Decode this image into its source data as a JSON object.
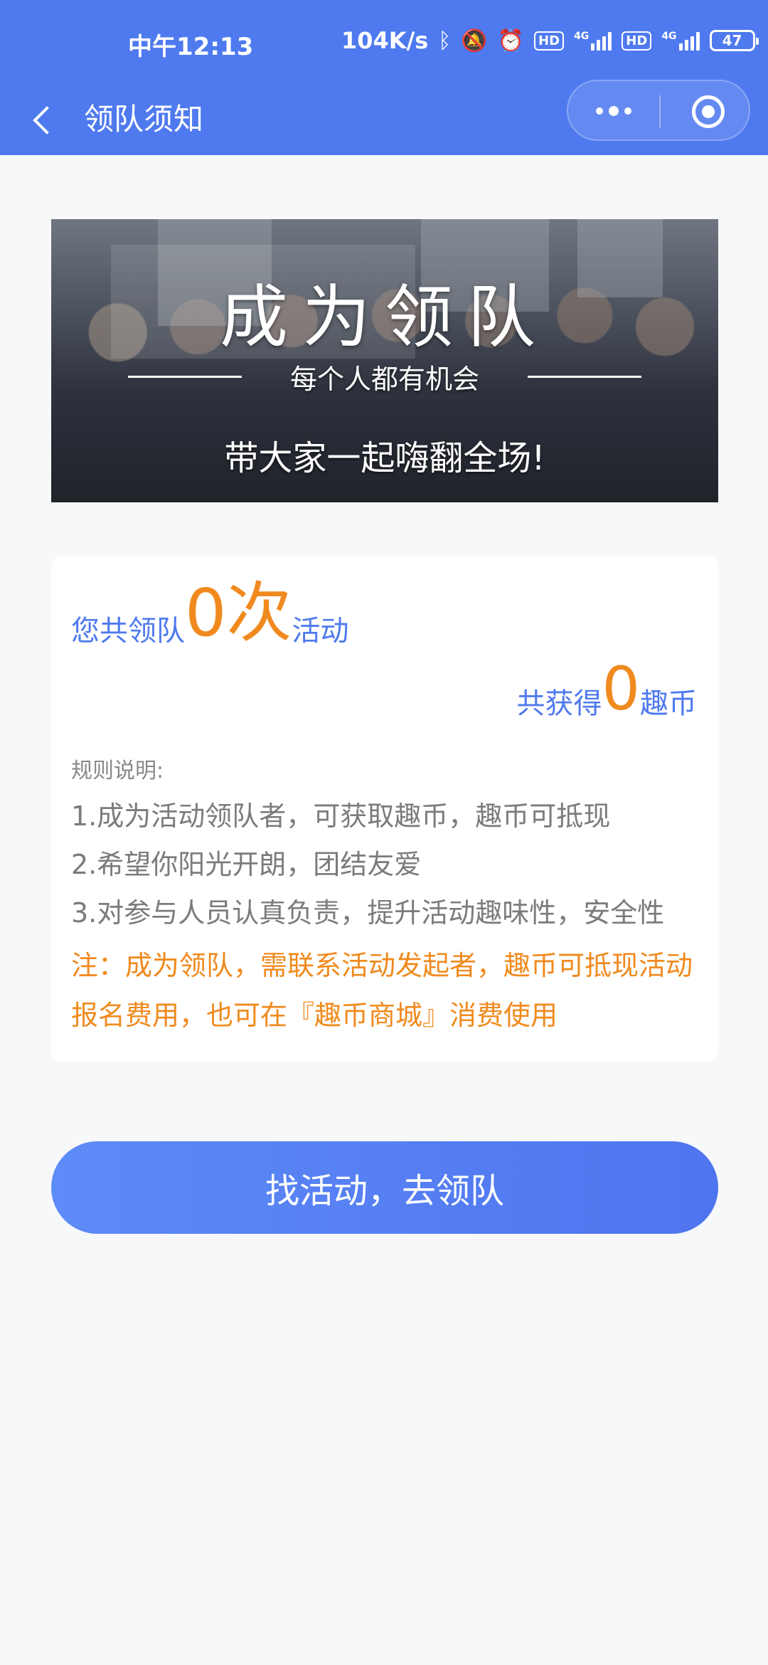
{
  "status_bar": {
    "time": "中午12:13",
    "speed": "104K/s",
    "battery": "47"
  },
  "nav": {
    "title": "领队须知"
  },
  "banner": {
    "title": "成为领队",
    "subtitle": "每个人都有机会",
    "tagline": "带大家一起嗨翻全场!"
  },
  "stats": {
    "lead_prefix": "您共领队",
    "lead_count": "0次",
    "lead_suffix": "活动",
    "coin_prefix": "共获得",
    "coin_count": "0",
    "coin_suffix": "趣币"
  },
  "rules": {
    "title": "规则说明:",
    "items": [
      "1.成为活动领队者，可获取趣币，趣币可抵现",
      "2.希望你阳光开朗，团结友爱",
      "3.对参与人员认真负责，提升活动趣味性，安全性"
    ],
    "note": "注：成为领队，需联系活动发起者，趣币可抵现活动报名费用，也可在『趣币商城』消费使用"
  },
  "cta": {
    "label": "找活动，去领队"
  },
  "colors": {
    "primary": "#4f7aef",
    "accent": "#f08a1e",
    "background": "#f7f8fa"
  }
}
